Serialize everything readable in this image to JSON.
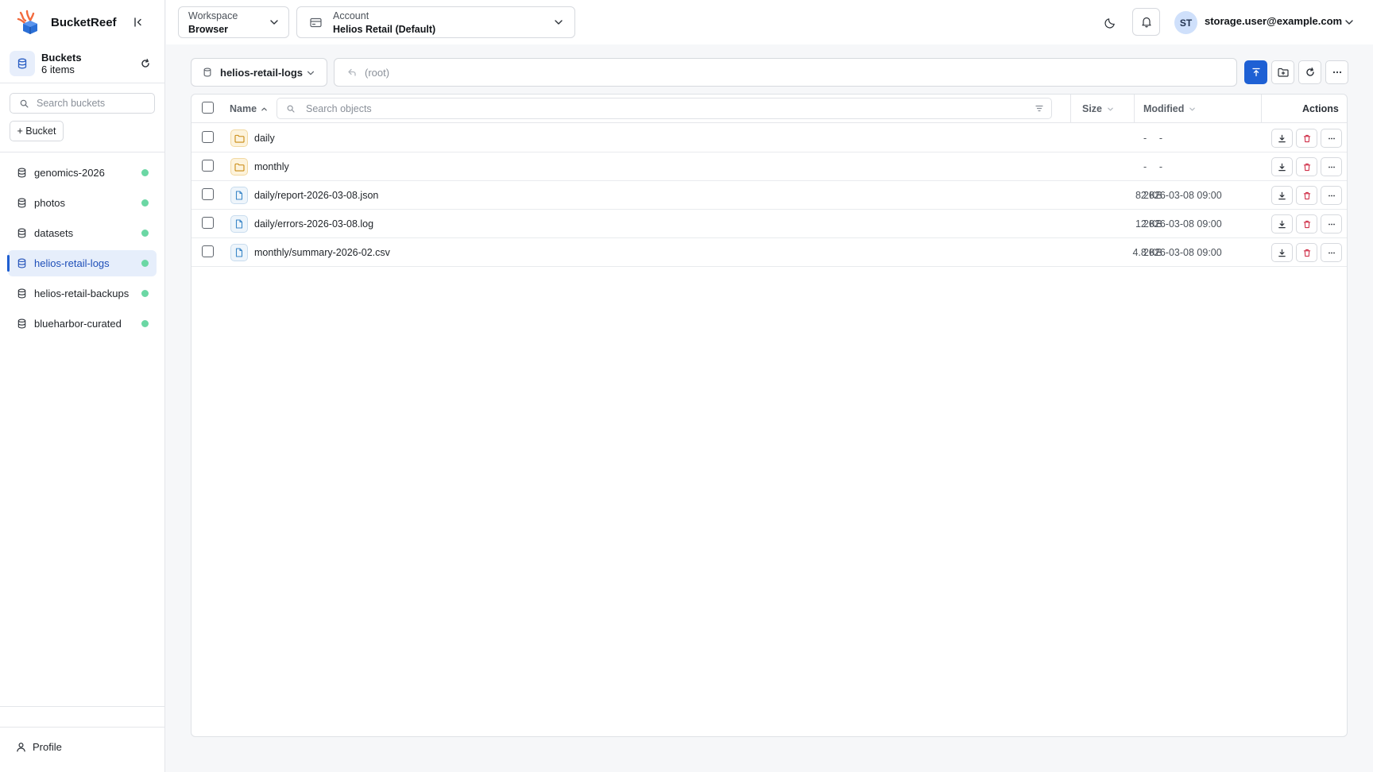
{
  "app": {
    "name": "BucketReef"
  },
  "sidebar": {
    "buckets_title": "Buckets",
    "buckets_count": "6 items",
    "search_placeholder": "Search buckets",
    "add_bucket_label": "+ Bucket",
    "items": [
      {
        "label": "genomics-2026",
        "status_color": "#6bd7a4"
      },
      {
        "label": "photos",
        "status_color": "#6bd7a4"
      },
      {
        "label": "datasets",
        "status_color": "#6bd7a4"
      },
      {
        "label": "helios-retail-logs",
        "status_color": "#6bd7a4",
        "active": true
      },
      {
        "label": "helios-retail-backups",
        "status_color": "#6bd7a4"
      },
      {
        "label": "blueharbor-curated",
        "status_color": "#6bd7a4"
      }
    ],
    "profile_label": "Profile"
  },
  "header": {
    "workspace": {
      "label": "Workspace",
      "value": "Browser"
    },
    "account": {
      "label": "Account",
      "value": "Helios Retail (Default)"
    },
    "user": {
      "initials": "ST",
      "email": "storage.user@example.com"
    }
  },
  "toolbar": {
    "bucket": "helios-retail-logs",
    "path": "(root)",
    "icons": [
      "upload-icon",
      "new-folder-icon",
      "refresh-icon",
      "more-icon"
    ]
  },
  "table": {
    "columns": {
      "name": "Name",
      "size": "Size",
      "modified": "Modified",
      "actions": "Actions"
    },
    "search_placeholder": "Search objects",
    "rows": [
      {
        "type": "folder",
        "name": "daily",
        "size": "-",
        "modified": "-"
      },
      {
        "type": "folder",
        "name": "monthly",
        "size": "-",
        "modified": "-"
      },
      {
        "type": "file",
        "name": "daily/report-2026-03-08.json",
        "size": "82 KB",
        "modified": "2026-03-08 09:00"
      },
      {
        "type": "file",
        "name": "daily/errors-2026-03-08.log",
        "size": "12 KB",
        "modified": "2026-03-08 09:00"
      },
      {
        "type": "file",
        "name": "monthly/summary-2026-02.csv",
        "size": "4.8 KB",
        "modified": "2026-03-08 09:00"
      }
    ]
  },
  "colors": {
    "accent": "#1e60d4",
    "active_bg": "#e6eefb",
    "danger": "#d0314a",
    "status_ok": "#6bd7a4"
  }
}
